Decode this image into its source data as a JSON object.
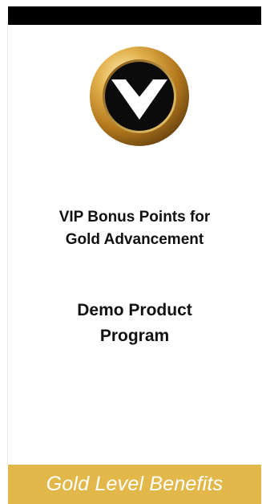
{
  "header": {
    "bar_color": "#000000"
  },
  "logo": {
    "icon": "gold-v-medallion-icon",
    "ring_color": "#c9962e",
    "inner_color": "#0b0b0b",
    "mark_color": "#ffffff"
  },
  "content": {
    "heading_lines": [
      "VIP Bonus Points for",
      "Gold Advancement"
    ],
    "subheading_lines": [
      "Demo Product",
      "Program"
    ]
  },
  "footer": {
    "label": "Gold Level Benefits",
    "color": "#e2b84a"
  }
}
